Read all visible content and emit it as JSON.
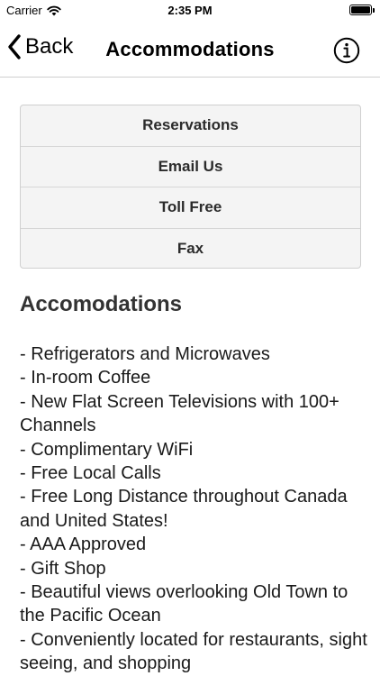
{
  "status_bar": {
    "carrier": "Carrier",
    "time": "2:35 PM"
  },
  "nav": {
    "back_label": "Back",
    "title": "Accommodations"
  },
  "actions": [
    {
      "label": "Reservations"
    },
    {
      "label": "Email Us"
    },
    {
      "label": "Toll Free"
    },
    {
      "label": "Fax"
    }
  ],
  "content": {
    "heading": "Accomodations",
    "items": [
      "- Refrigerators and Microwaves",
      "- In-room Coffee",
      "- New Flat Screen Televisions with 100+ Channels",
      "- Complimentary WiFi",
      "- Free Local Calls",
      "- Free Long Distance throughout Canada and United States!",
      "- AAA Approved",
      "- Gift Shop",
      "- Beautiful views overlooking Old Town to the Pacific Ocean",
      "- Conveniently located for restaurants, sight seeing, and shopping"
    ]
  }
}
